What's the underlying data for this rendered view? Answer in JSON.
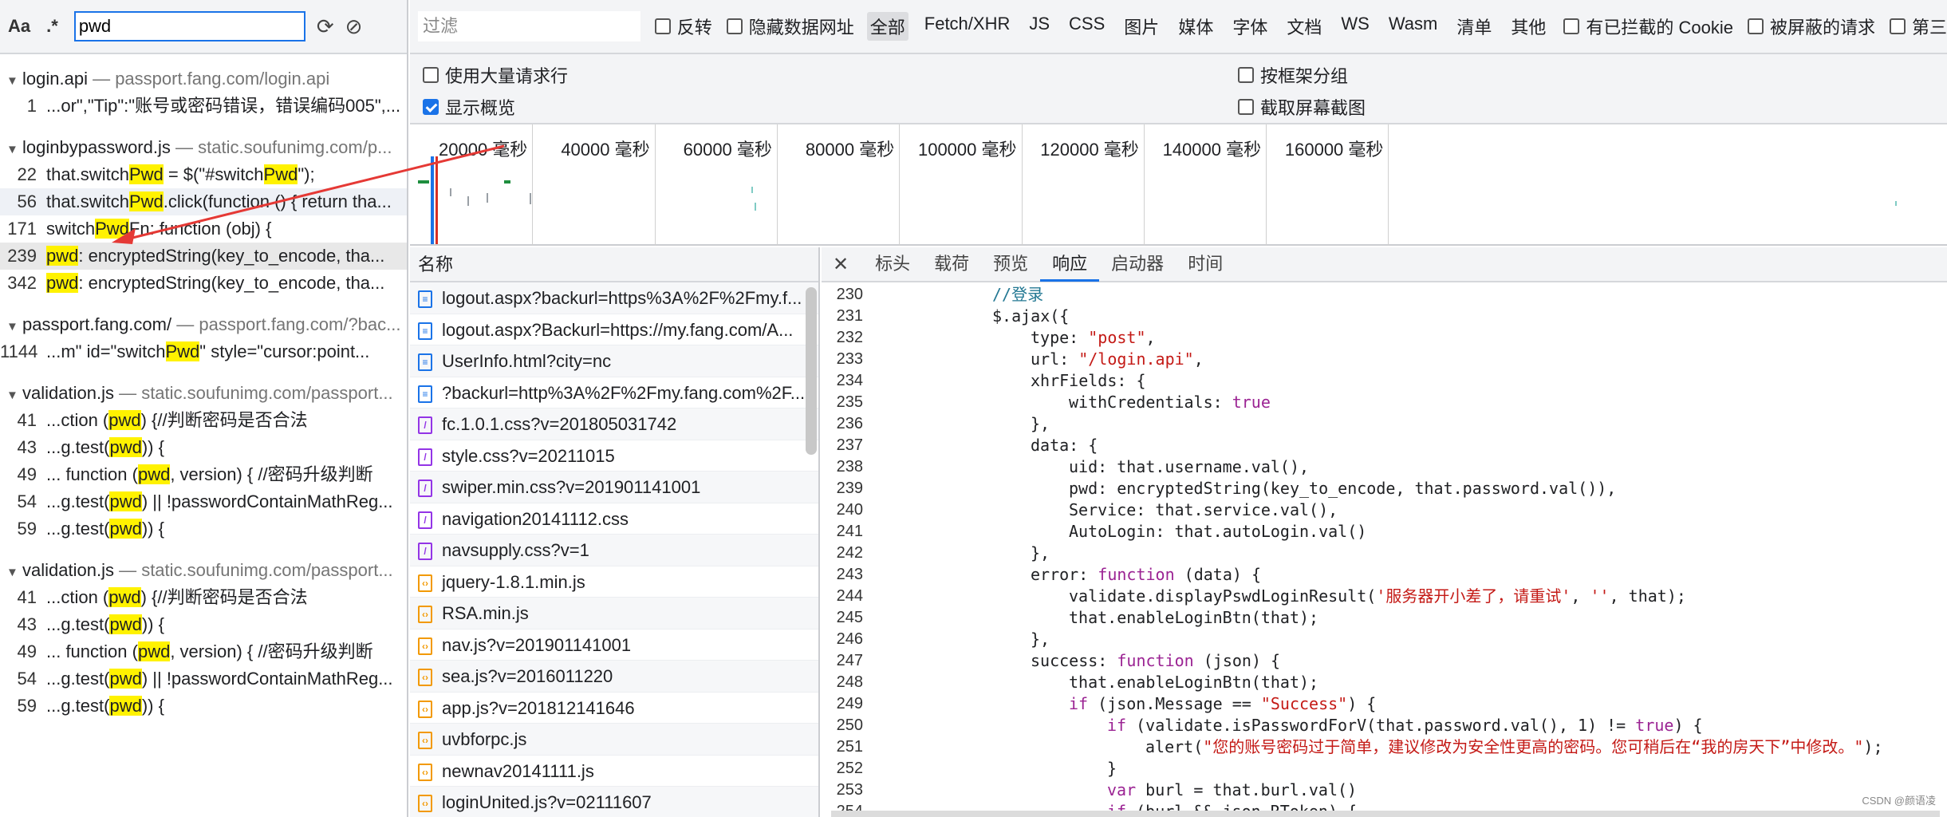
{
  "search": {
    "case_label": "Aa",
    "regex_label": ".*",
    "query": "pwd"
  },
  "results": [
    {
      "file": "login.api",
      "source": "passport.fang.com/login.api",
      "lines": [
        {
          "no": "1",
          "segs": [
            {
              "t": "...or\",\"Tip\":\"账号或密码错误，错误编码005\",..."
            }
          ]
        }
      ]
    },
    {
      "file": "loginbypassword.js",
      "source": "static.soufunimg.com/p...",
      "lines": [
        {
          "no": "22",
          "segs": [
            {
              "t": "that.switch"
            },
            {
              "t": "Pwd",
              "h": true
            },
            {
              "t": " = $(\"#switch"
            },
            {
              "t": "Pwd",
              "h": true
            },
            {
              "t": "\");"
            }
          ]
        },
        {
          "no": "56",
          "segs": [
            {
              "t": "that.switch"
            },
            {
              "t": "Pwd",
              "h": true
            },
            {
              "t": ".click(function () { return tha..."
            }
          ]
        },
        {
          "no": "171",
          "segs": [
            {
              "t": "switch"
            },
            {
              "t": "Pwd",
              "h": true
            },
            {
              "t": "Fn: function (obj) {"
            }
          ]
        },
        {
          "no": "239",
          "segs": [
            {
              "t": "pwd",
              "h": true
            },
            {
              "t": ": encryptedString(key_to_encode, tha..."
            }
          ]
        },
        {
          "no": "342",
          "segs": [
            {
              "t": "pwd",
              "h": true
            },
            {
              "t": ": encryptedString(key_to_encode, tha..."
            }
          ]
        }
      ]
    },
    {
      "file": "passport.fang.com/",
      "source": "passport.fang.com/?bac...",
      "lines": [
        {
          "no": "1144",
          "segs": [
            {
              "t": "...m\" id=\"switch"
            },
            {
              "t": "Pwd",
              "h": true
            },
            {
              "t": "\" style=\"cursor:point..."
            }
          ]
        }
      ]
    },
    {
      "file": "validation.js",
      "source": "static.soufunimg.com/passport...",
      "lines": [
        {
          "no": "41",
          "segs": [
            {
              "t": "...ction ("
            },
            {
              "t": "pwd",
              "h": true
            },
            {
              "t": ") {//判断密码是否合法"
            }
          ]
        },
        {
          "no": "43",
          "segs": [
            {
              "t": "...g.test("
            },
            {
              "t": "pwd",
              "h": true
            },
            {
              "t": ")) {"
            }
          ]
        },
        {
          "no": "49",
          "segs": [
            {
              "t": "... function ("
            },
            {
              "t": "pwd",
              "h": true
            },
            {
              "t": ", version) { //密码升级判断"
            }
          ]
        },
        {
          "no": "54",
          "segs": [
            {
              "t": "...g.test("
            },
            {
              "t": "pwd",
              "h": true
            },
            {
              "t": ") || !passwordContainMathReg..."
            }
          ]
        },
        {
          "no": "59",
          "segs": [
            {
              "t": "...g.test("
            },
            {
              "t": "pwd",
              "h": true
            },
            {
              "t": ")) {"
            }
          ]
        }
      ]
    },
    {
      "file": "validation.js",
      "source": "static.soufunimg.com/passport...",
      "lines": [
        {
          "no": "41",
          "segs": [
            {
              "t": "...ction ("
            },
            {
              "t": "pwd",
              "h": true
            },
            {
              "t": ") {//判断密码是否合法"
            }
          ]
        },
        {
          "no": "43",
          "segs": [
            {
              "t": "...g.test("
            },
            {
              "t": "pwd",
              "h": true
            },
            {
              "t": ")) {"
            }
          ]
        },
        {
          "no": "49",
          "segs": [
            {
              "t": "... function ("
            },
            {
              "t": "pwd",
              "h": true
            },
            {
              "t": ", version) { //密码升级判断"
            }
          ]
        },
        {
          "no": "54",
          "segs": [
            {
              "t": "...g.test("
            },
            {
              "t": "pwd",
              "h": true
            },
            {
              "t": ") || !passwordContainMathReg..."
            }
          ]
        },
        {
          "no": "59",
          "segs": [
            {
              "t": "...g.test("
            },
            {
              "t": "pwd",
              "h": true
            },
            {
              "t": ")) {"
            }
          ]
        }
      ]
    }
  ],
  "filterbar": {
    "placeholder": "过滤",
    "invert": "反转",
    "hide_data_urls": "隐藏数据网址",
    "types": [
      "全部",
      "Fetch/XHR",
      "JS",
      "CSS",
      "图片",
      "媒体",
      "字体",
      "文档",
      "WS",
      "Wasm",
      "清单",
      "其他"
    ],
    "blocked_cookies": "有已拦截的 Cookie",
    "blocked_requests": "被屏蔽的请求",
    "third_party": "第三"
  },
  "options": {
    "large_rows": "使用大量请求行",
    "group_by_frame": "按框架分组",
    "show_overview": "显示概览",
    "capture_screenshots": "截取屏幕截图"
  },
  "timeline": {
    "labels": [
      "20000 毫秒",
      "40000 毫秒",
      "60000 毫秒",
      "80000 毫秒",
      "100000 毫秒",
      "120000 毫秒",
      "140000 毫秒",
      "160000 毫秒"
    ]
  },
  "requests": {
    "header": "名称",
    "items": [
      {
        "name": "logout.aspx?backurl=https%3A%2F%2Fmy.f...",
        "kind": "doc"
      },
      {
        "name": "logout.aspx?Backurl=https://my.fang.com/A...",
        "kind": "doc"
      },
      {
        "name": "UserInfo.html?city=nc",
        "kind": "doc"
      },
      {
        "name": "?backurl=http%3A%2F%2Fmy.fang.com%2F...",
        "kind": "doc"
      },
      {
        "name": "fc.1.0.1.css?v=201805031742",
        "kind": "css"
      },
      {
        "name": "style.css?v=20211015",
        "kind": "css"
      },
      {
        "name": "swiper.min.css?v=201901141001",
        "kind": "css"
      },
      {
        "name": "navigation20141112.css",
        "kind": "css"
      },
      {
        "name": "navsupply.css?v=1",
        "kind": "css"
      },
      {
        "name": "jquery-1.8.1.min.js",
        "kind": "js"
      },
      {
        "name": "RSA.min.js",
        "kind": "js"
      },
      {
        "name": "nav.js?v=201901141001",
        "kind": "js"
      },
      {
        "name": "sea.js?v=2016011220",
        "kind": "js"
      },
      {
        "name": "app.js?v=201812141646",
        "kind": "js"
      },
      {
        "name": "uvbforpc.js",
        "kind": "js"
      },
      {
        "name": "newnav20141111.js",
        "kind": "js"
      },
      {
        "name": "loginUnited.js?v=02111607",
        "kind": "js"
      }
    ]
  },
  "detail_tabs": [
    "标头",
    "载荷",
    "预览",
    "响应",
    "启动器",
    "时间"
  ],
  "code": [
    {
      "no": "230",
      "indent": 12,
      "toks": [
        [
          "c",
          "//登录"
        ]
      ]
    },
    {
      "no": "231",
      "indent": 12,
      "toks": [
        [
          "p",
          "$.ajax({"
        ]
      ]
    },
    {
      "no": "232",
      "indent": 16,
      "toks": [
        [
          "p",
          "type: "
        ],
        [
          "s",
          "\"post\""
        ],
        [
          "p",
          ","
        ]
      ]
    },
    {
      "no": "233",
      "indent": 16,
      "toks": [
        [
          "p",
          "url: "
        ],
        [
          "s",
          "\"/login.api\""
        ],
        [
          "p",
          ","
        ]
      ]
    },
    {
      "no": "234",
      "indent": 16,
      "toks": [
        [
          "p",
          "xhrFields: {"
        ]
      ]
    },
    {
      "no": "235",
      "indent": 20,
      "toks": [
        [
          "p",
          "withCredentials: "
        ],
        [
          "k",
          "true"
        ]
      ]
    },
    {
      "no": "236",
      "indent": 16,
      "toks": [
        [
          "p",
          "},"
        ]
      ]
    },
    {
      "no": "237",
      "indent": 16,
      "toks": [
        [
          "p",
          "data: {"
        ]
      ]
    },
    {
      "no": "238",
      "indent": 20,
      "toks": [
        [
          "p",
          "uid: that.username.val(),"
        ]
      ]
    },
    {
      "no": "239",
      "indent": 20,
      "toks": [
        [
          "p",
          "pwd: encryptedString(key_to_encode, that.password.val()),"
        ]
      ]
    },
    {
      "no": "240",
      "indent": 20,
      "toks": [
        [
          "p",
          "Service: that.service.val(),"
        ]
      ]
    },
    {
      "no": "241",
      "indent": 20,
      "toks": [
        [
          "p",
          "AutoLogin: that.autoLogin.val()"
        ]
      ]
    },
    {
      "no": "242",
      "indent": 16,
      "toks": [
        [
          "p",
          "},"
        ]
      ]
    },
    {
      "no": "243",
      "indent": 16,
      "toks": [
        [
          "p",
          "error: "
        ],
        [
          "k",
          "function"
        ],
        [
          "p",
          " (data) {"
        ]
      ]
    },
    {
      "no": "244",
      "indent": 20,
      "toks": [
        [
          "p",
          "validate.displayPswdLoginResult("
        ],
        [
          "s",
          "'服务器开小差了，请重试'"
        ],
        [
          "p",
          ", "
        ],
        [
          "s",
          "''"
        ],
        [
          "p",
          ", that);"
        ]
      ]
    },
    {
      "no": "245",
      "indent": 20,
      "toks": [
        [
          "p",
          "that.enableLoginBtn(that);"
        ]
      ]
    },
    {
      "no": "246",
      "indent": 16,
      "toks": [
        [
          "p",
          "},"
        ]
      ]
    },
    {
      "no": "247",
      "indent": 16,
      "toks": [
        [
          "p",
          "success: "
        ],
        [
          "k",
          "function"
        ],
        [
          "p",
          " (json) {"
        ]
      ]
    },
    {
      "no": "248",
      "indent": 20,
      "toks": [
        [
          "p",
          "that.enableLoginBtn(that);"
        ]
      ]
    },
    {
      "no": "249",
      "indent": 20,
      "toks": [
        [
          "k",
          "if"
        ],
        [
          "p",
          " (json.Message == "
        ],
        [
          "s",
          "\"Success\""
        ],
        [
          "p",
          ") {"
        ]
      ]
    },
    {
      "no": "250",
      "indent": 24,
      "toks": [
        [
          "k",
          "if"
        ],
        [
          "p",
          " (validate.isPasswordForV(that.password.val(), 1) != "
        ],
        [
          "k",
          "true"
        ],
        [
          "p",
          ") {"
        ]
      ]
    },
    {
      "no": "251",
      "indent": 28,
      "toks": [
        [
          "p",
          "alert("
        ],
        [
          "s",
          "\"您的账号密码过于简单，建议修改为安全性更高的密码。您可稍后在“我的房天下”中修改。\""
        ],
        [
          "p",
          ");"
        ]
      ]
    },
    {
      "no": "252",
      "indent": 24,
      "toks": [
        [
          "p",
          "}"
        ]
      ]
    },
    {
      "no": "253",
      "indent": 24,
      "toks": [
        [
          "k",
          "var"
        ],
        [
          "p",
          " burl = that.burl.val()"
        ]
      ]
    },
    {
      "no": "254",
      "indent": 24,
      "toks": [
        [
          "k",
          "if"
        ],
        [
          "p",
          " (burl && json.RToken) {"
        ]
      ]
    }
  ],
  "watermark": "CSDN @颜语凌"
}
